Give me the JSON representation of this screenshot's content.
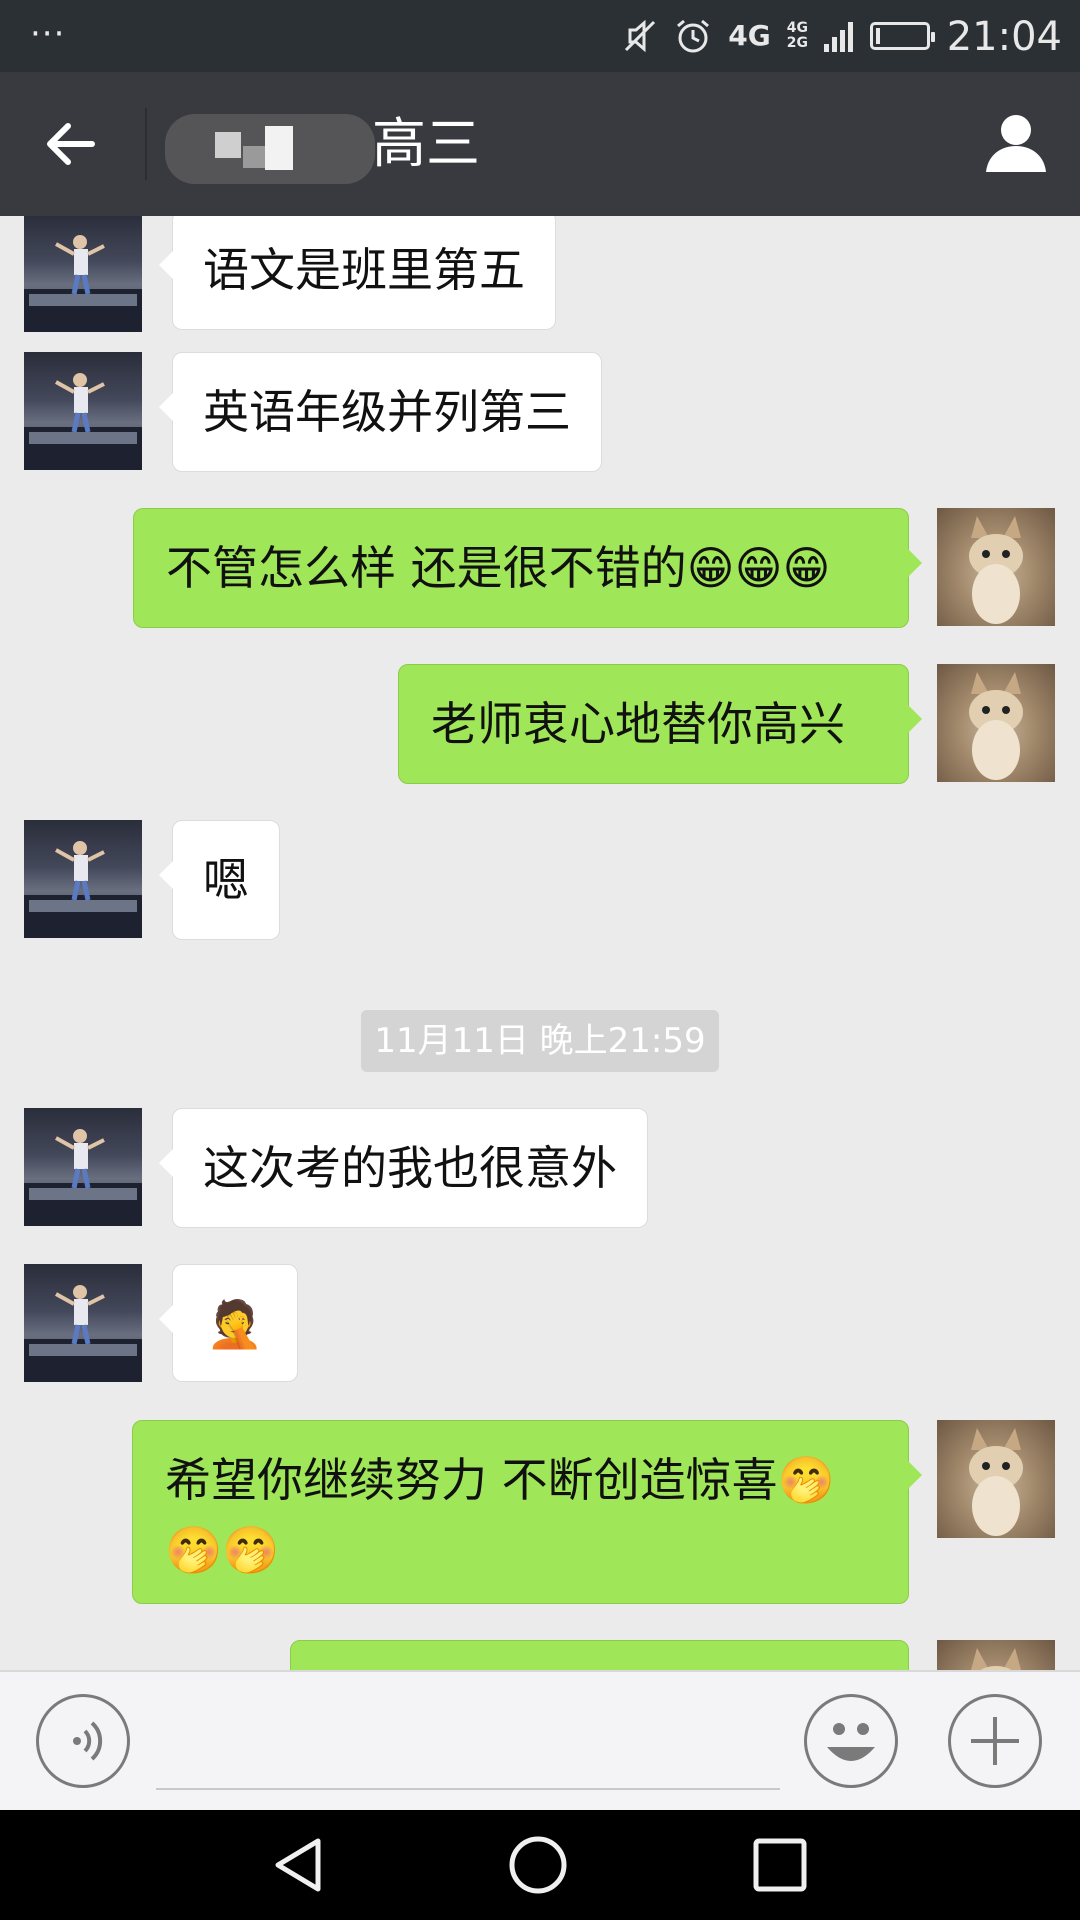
{
  "status_bar": {
    "overflow": "···",
    "network_primary": "4G",
    "network_secondary_top": "4G",
    "network_secondary_bottom": "2G",
    "time": "21:04",
    "battery_level": 0.1,
    "icons": [
      "mute-icon",
      "alarm-icon",
      "signal-icon",
      "battery-icon"
    ]
  },
  "header": {
    "back_icon": "arrow-left-icon",
    "title": "高三",
    "profile_icon": "person-icon"
  },
  "messages": [
    {
      "side": "left",
      "text": "语文是班里第五"
    },
    {
      "side": "left",
      "text": "英语年级并列第三"
    },
    {
      "side": "right",
      "text": "不管怎么样 还是很不错的😁😁😁"
    },
    {
      "side": "right",
      "text": "老师衷心地替你高兴"
    },
    {
      "side": "left",
      "text": "嗯"
    },
    {
      "side": "left",
      "text": "这次考的我也很意外"
    },
    {
      "side": "left",
      "text": "🤦"
    },
    {
      "side": "right",
      "text": "希望你继续努力 不断创造惊喜🤭🤭🤭"
    },
    {
      "side": "right",
      "text": ""
    }
  ],
  "timestamp": "11月11日 晚上21:59",
  "input_bar": {
    "voice_icon": "voice-icon",
    "input_value": "",
    "emoji_icon": "smiley-icon",
    "more_icon": "plus-icon"
  },
  "nav_bar": {
    "icons": [
      "back-triangle-icon",
      "home-circle-icon",
      "recents-square-icon"
    ]
  },
  "colors": {
    "title_bar": "#393a3f",
    "status_bar": "#2b3034",
    "chat_background": "#ebebeb",
    "bubble_sent": "#9fe658",
    "bubble_received": "#ffffff"
  }
}
